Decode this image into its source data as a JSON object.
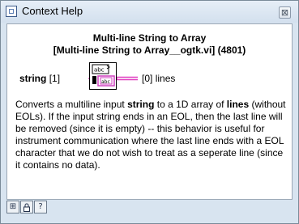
{
  "window": {
    "title": "Context Help",
    "close_glyph": "⊠"
  },
  "help": {
    "function_name": "Multi-line String to Array",
    "function_path": "[Multi-line String to Array__ogtk.vi] (4801)",
    "input_terminal": {
      "name": "string",
      "index": "[1]"
    },
    "output_terminal": {
      "index": "[0]",
      "name": "lines"
    },
    "vi_icon_label": "abc",
    "description": {
      "p1": "Converts a multiline input ",
      "b1": "string",
      "p2": " to a 1D array of ",
      "b2": "lines",
      "p3": " (without EOLs). If the input string ends in an EOL, then the last line will be removed (since it is empty) -- this behavior is useful for instrument communication where the last line ends with a EOL character that we do not wish to treat as a seperate line (since it contains no data)."
    }
  },
  "toolbar": {
    "buttons": [
      {
        "icon": "hierarchy-icon",
        "glyph": "⊞"
      },
      {
        "icon": "lock-icon",
        "glyph": "🔒"
      },
      {
        "icon": "help-icon",
        "glyph": "?"
      }
    ]
  },
  "colors": {
    "wire_pink": "#e040c0",
    "icon_border": "#000000",
    "window_frame": "#d8e4f0"
  }
}
